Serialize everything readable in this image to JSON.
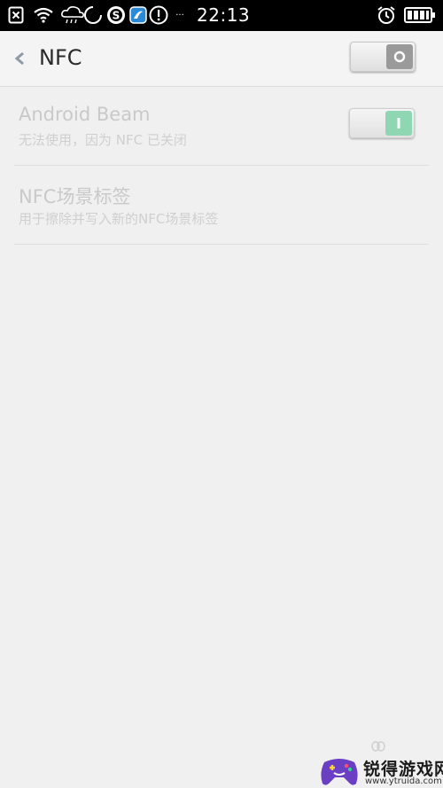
{
  "status_bar": {
    "time": "22:13",
    "overflow_dots": "···",
    "icons": [
      "sim-error-icon",
      "wifi-icon",
      "rain-cloud-icon",
      "loading-ring-icon",
      "s-app-icon",
      "blue-app-icon",
      "alert-icon",
      "alarm-icon",
      "battery-icon"
    ]
  },
  "header": {
    "back_label": "‹",
    "title": "NFC",
    "nfc_switch_state": "off"
  },
  "settings": [
    {
      "title": "Android Beam",
      "subtitle": "无法使用，因为 NFC 已关闭",
      "switch_state": "on"
    },
    {
      "title": "NFC场景标签",
      "subtitle": "用于擦除并写入新的NFC场景标签"
    }
  ],
  "watermark": {
    "text": "锐得游戏网",
    "url": "www.ytruida.com"
  },
  "colors": {
    "background": "#f0f0f0",
    "status_bar": "#000000",
    "switch_on": "#7fd3a8",
    "switch_off": "#9a9a9a",
    "disabled_text": "#c9c9c9"
  }
}
